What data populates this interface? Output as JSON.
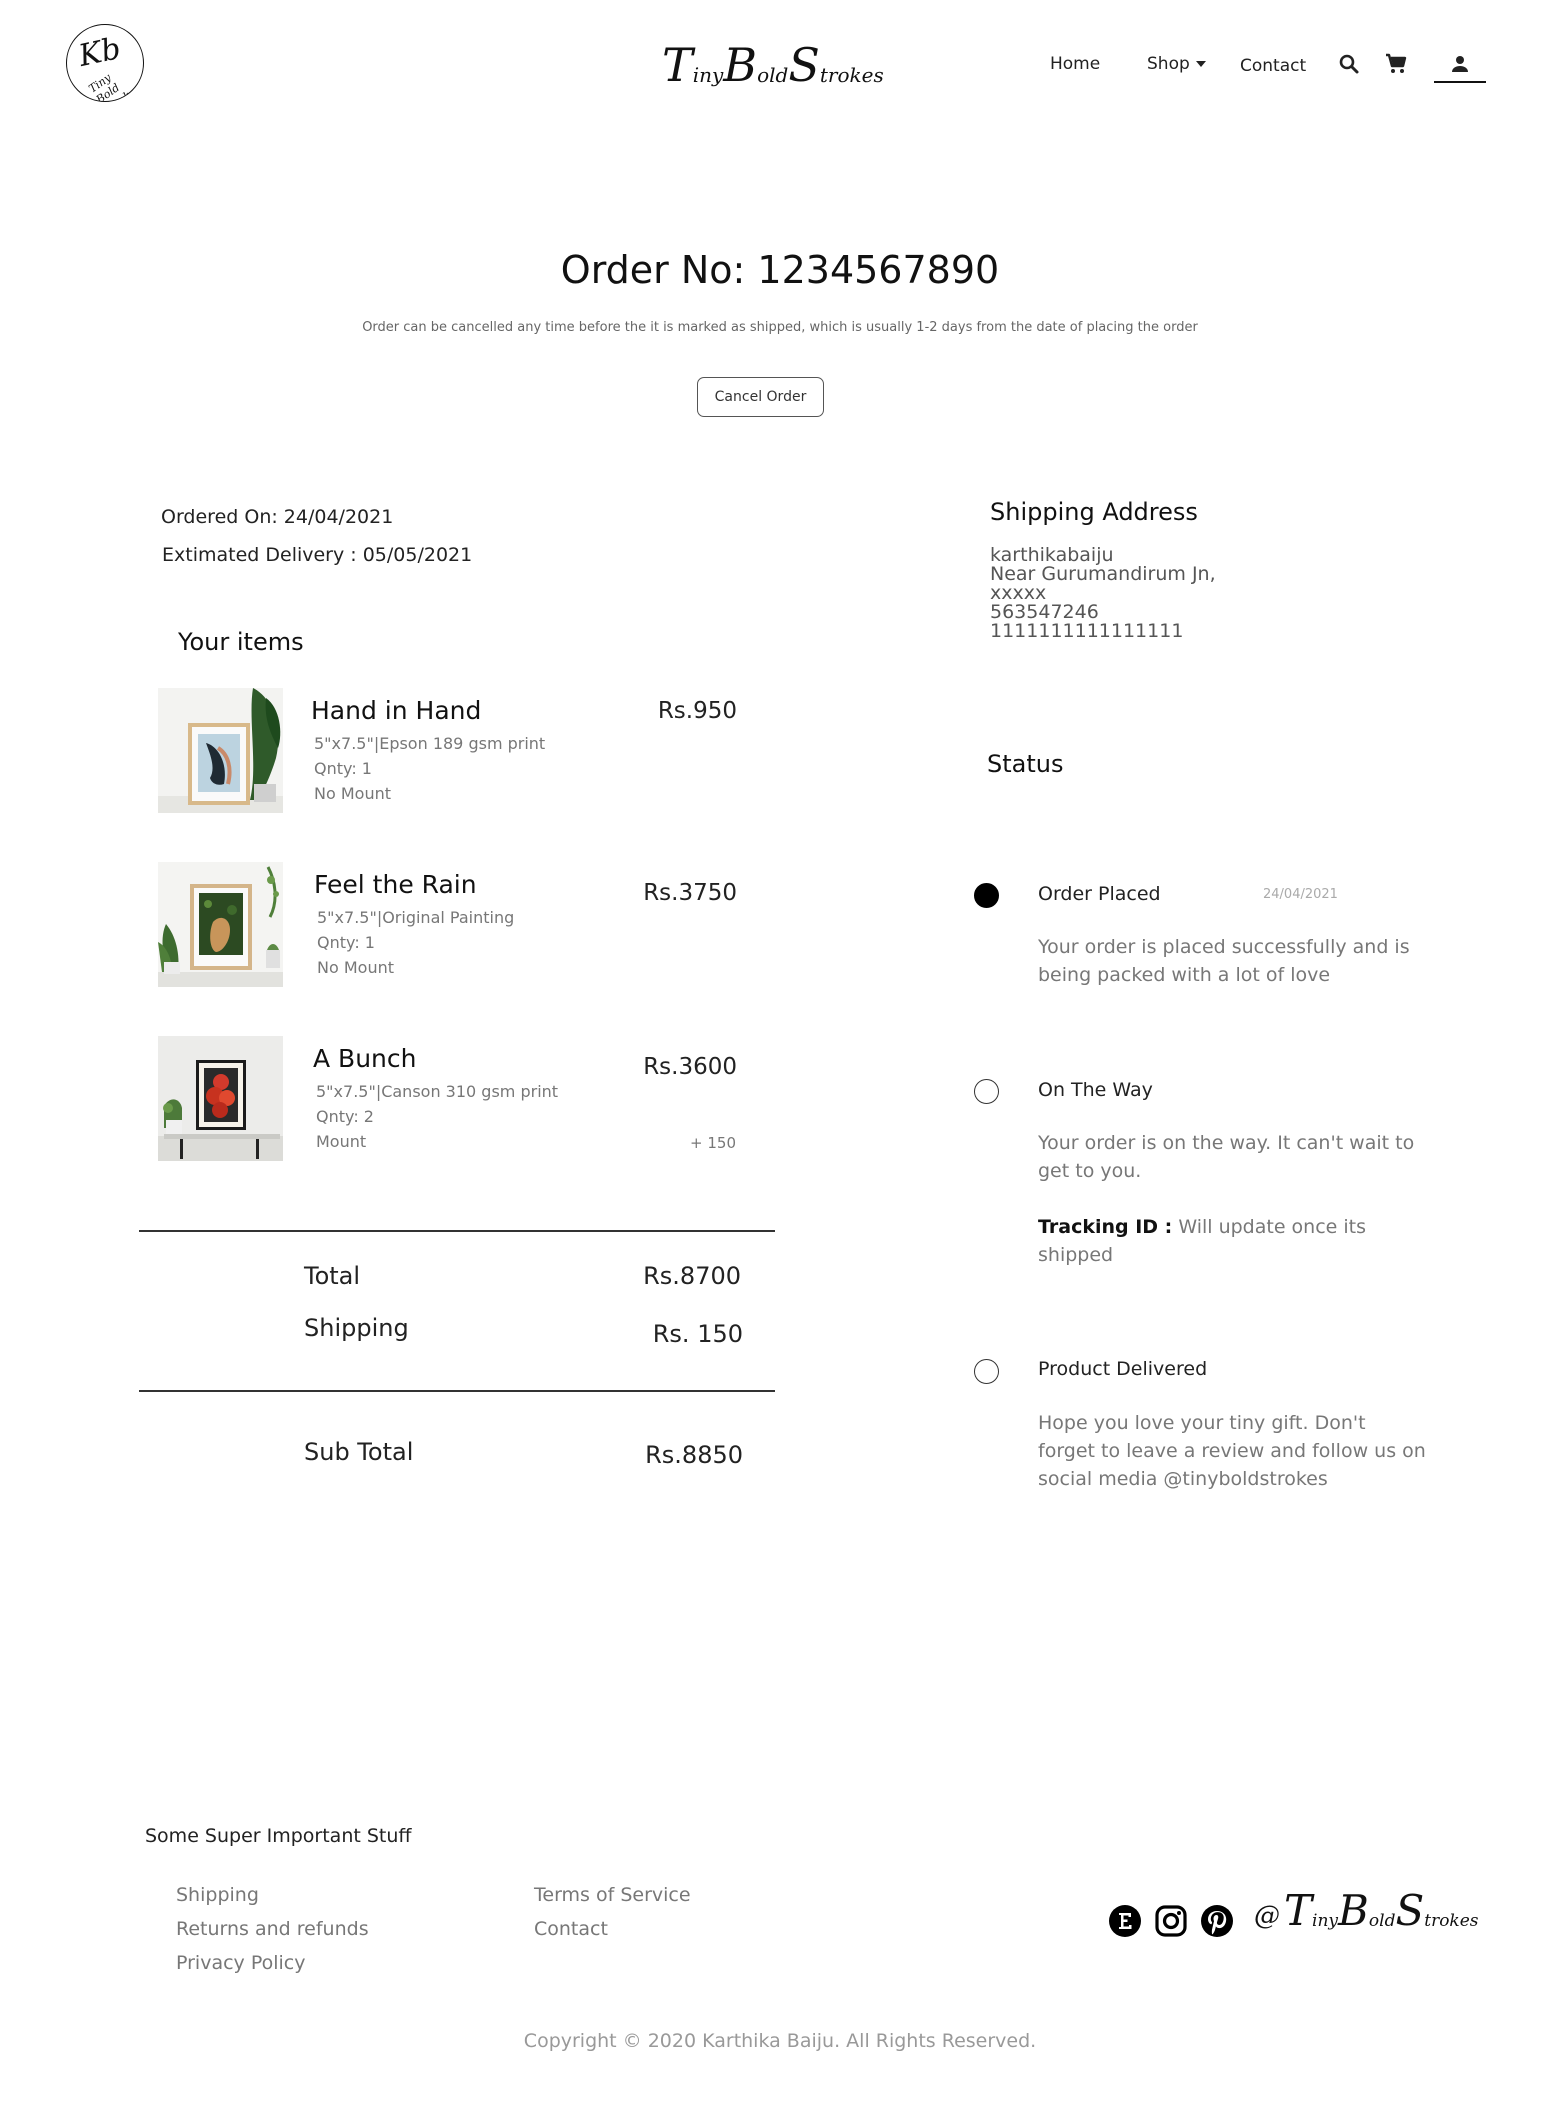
{
  "header": {
    "logo_mono": "Kb",
    "logo_text": "Tiny Bold Strokes",
    "brand": [
      {
        "t": "T",
        "big": true
      },
      {
        "t": "iny",
        "big": false
      },
      {
        "t": "B",
        "big": true
      },
      {
        "t": "old",
        "big": false
      },
      {
        "t": "S",
        "big": true
      },
      {
        "t": "trokes",
        "big": false
      }
    ],
    "nav": {
      "home": "Home",
      "shop": "Shop",
      "contact": "Contact"
    },
    "icons": {
      "search": "search-icon",
      "cart": "cart-icon",
      "account": "person-icon"
    }
  },
  "order": {
    "title": "Order No: 1234567890",
    "note": "Order can be  cancelled any time before the it is marked as shipped, which is usually 1-2 days from the date of placing the order",
    "cancel_label": "Cancel Order",
    "ordered_on": "Ordered On: 24/04/2021",
    "estimated_delivery": "Extimated Delivery : 05/05/2021"
  },
  "items_heading": "Your items",
  "items": [
    {
      "name": "Hand in Hand",
      "spec": "5\"x7.5\"|Epson 189 gsm print",
      "qty": "Qnty: 1",
      "mount": "No Mount",
      "price": "Rs.950",
      "addon": ""
    },
    {
      "name": "Feel the Rain",
      "spec": "5\"x7.5\"|Original Painting",
      "qty": "Qnty: 1",
      "mount": "No Mount",
      "price": "Rs.3750",
      "addon": ""
    },
    {
      "name": "A Bunch",
      "spec": "5\"x7.5\"|Canson 310 gsm print",
      "qty": "Qnty: 2",
      "mount": "Mount",
      "price": "Rs.3600",
      "addon": "+ 150"
    }
  ],
  "totals": {
    "total_label": "Total",
    "total_value": "Rs.8700",
    "shipping_label": "Shipping",
    "shipping_value": "Rs. 150",
    "subtotal_label": "Sub Total",
    "subtotal_value": "Rs.8850"
  },
  "shipping_address": {
    "heading": "Shipping Address",
    "lines": [
      "karthikabaiju",
      "Near Gurumandirum Jn,",
      "xxxxx",
      "563547246",
      "1111111111111111"
    ]
  },
  "status": {
    "heading": "Status",
    "steps": [
      {
        "title": "Order Placed",
        "date": "24/04/2021",
        "desc": "Your order is placed successfully and is being packed with a lot of love",
        "done": true
      },
      {
        "title": "On The Way",
        "date": "",
        "desc": "Your order is on the way. It can't wait to get to you.",
        "tracking_label": "Tracking ID :",
        "tracking_value": " Will update once its shipped",
        "done": false
      },
      {
        "title": "Product Delivered",
        "date": "",
        "desc": "Hope you love your tiny gift. Don't forget to leave a review and follow us on social media @tinyboldstrokes",
        "done": false
      }
    ]
  },
  "footer": {
    "heading": "Some Super Important Stuff",
    "links_col1": [
      "Shipping",
      "Returns and refunds",
      "Privacy Policy"
    ],
    "links_col2": [
      "Terms of Service",
      "Contact"
    ],
    "social_icons": [
      "etsy-icon",
      "instagram-icon",
      "pinterest-icon"
    ],
    "handle_at": "@",
    "copyright": "Copyright © 2020 Karthika Baiju. All Rights Reserved."
  }
}
